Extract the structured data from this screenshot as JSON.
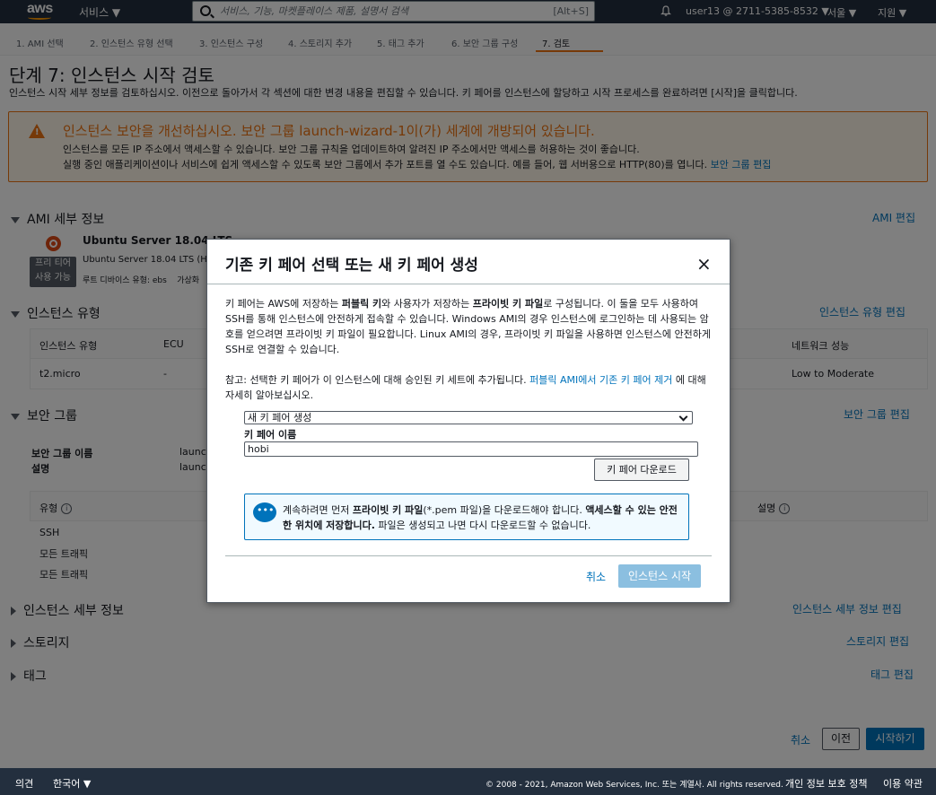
{
  "nav": {
    "logo": "aws",
    "services": "서비스 ▼",
    "search_placeholder": "서비스, 기능, 마켓플레이스 제품, 설명서 검색",
    "search_shortcut": "[Alt+S]",
    "account": "user13 @ 2711-5385-8532 ▼",
    "region": "서울 ▼",
    "support": "지원 ▼"
  },
  "steps": [
    "1. AMI 선택",
    "2. 인스턴스 유형 선택",
    "3. 인스턴스 구성",
    "4. 스토리지 추가",
    "5. 태그 추가",
    "6. 보안 그룹 구성",
    "7. 검토"
  ],
  "page": {
    "title": "단계 7: 인스턴스 시작 검토",
    "subtitle": "인스턴스 시작 세부 정보를 검토하십시오. 이전으로 돌아가서 각 섹션에 대한 변경 내용을 편집할 수 있습니다. 키 페어를 인스턴스에 할당하고 시작 프로세스를 완료하려면 [시작]을 클릭합니다."
  },
  "warning": {
    "title": "인스턴스 보안을 개선하십시오. 보안 그룹 launch-wizard-1이(가) 세계에 개방되어 있습니다.",
    "line1": "인스턴스를 모든 IP 주소에서 액세스할 수 있습니다. 보안 그룹 규칙을 업데이트하여 알려진 IP 주소에서만 액세스를 허용하는 것이 좋습니다.",
    "line2": "실행 중인 애플리케이션이나 서비스에 쉽게 액세스할 수 있도록 보안 그룹에서 추가 포트를 열 수도 있습니다. 예를 들어, 웹 서버용으로 HTTP(80)를 엽니다.",
    "line2_link": "보안 그룹 편집"
  },
  "ami": {
    "heading": "AMI 세부 정보",
    "edit": "AMI 편집",
    "name": "Ubuntu Server 18.04 LTS",
    "sub": "Ubuntu Server 18.04 LTS (H",
    "free_tier_1": "프리 티어",
    "free_tier_2": "사용 가능",
    "root_device": "루트 디바이스 유형: ebs",
    "virt": "가상화"
  },
  "instance_type": {
    "heading": "인스턴스 유형",
    "edit": "인스턴스 유형 편집",
    "columns": [
      "인스턴스 유형",
      "ECU",
      "네트워크 성능"
    ],
    "row": [
      "t2.micro",
      "-",
      "Low to Moderate"
    ]
  },
  "security_group": {
    "heading": "보안 그룹",
    "edit": "보안 그룹 편집",
    "name_label": "보안 그룹 이름",
    "desc_label": "설명",
    "name_value": "launc",
    "desc_value": "launc",
    "col_type": "유형",
    "col_desc": "설명",
    "info": "i",
    "rows": [
      "SSH",
      "모든 트래픽",
      "모든 트래픽"
    ]
  },
  "collapsed": [
    {
      "heading": "인스턴스 세부 정보",
      "edit": "인스턴스 세부 정보 편집"
    },
    {
      "heading": "스토리지",
      "edit": "스토리지 편집"
    },
    {
      "heading": "태그",
      "edit": "태그 편집"
    }
  ],
  "actions": {
    "cancel": "취소",
    "previous": "이전",
    "launch": "시작하기"
  },
  "footer": {
    "feedback": "의견",
    "language": "한국어 ▼",
    "copyright": "© 2008 - 2021, Amazon Web Services, Inc. 또는 계열사. All rights reserved.",
    "privacy": "개인 정보 보호 정책",
    "terms": "이용 약관"
  },
  "modal": {
    "title": "기존 키 페어 선택 또는 새 키 페어 생성",
    "close": "×",
    "para1_a": "키 페어는 AWS에 저장하는 ",
    "para1_b": "퍼블릭 키",
    "para1_c": "와 사용자가 저장하는 ",
    "para1_d": "프라이빗 키 파일",
    "para1_e": "로 구성됩니다. 이 둘을 모두 사용하여 SSH를 통해 인스턴스에 안전하게 접속할 수 있습니다. Windows AMI의 경우 인스턴스에 로그인하는 데 사용되는 암호를 얻으려면 프라이빗 키 파일이 필요합니다. Linux AMI의 경우, 프라이빗 키 파일을 사용하면 인스턴스에 안전하게 SSH로 연결할 수 있습니다.",
    "para2_a": "참고: 선택한 키 페어가 이 인스턴스에 대해 승인된 키 세트에 추가됩니다. ",
    "para2_link": "퍼블릭 AMI에서 기존 키 페어 제거",
    "para2_c": " 에 대해 자세히 알아보십시오.",
    "select_value": "새 키 페어 생성",
    "key_name_label": "키 페어 이름",
    "key_name_value": "hobi",
    "download": "키 페어 다운로드",
    "info_a": "계속하려면 먼저 ",
    "info_b": "프라이빗 키 파일",
    "info_c": "(*.pem 파일)을 다운로드해야 합니다. ",
    "info_d": "액세스할 수 있는 안전한 위치에 저장합니다.",
    "info_e": " 파일은 생성되고 나면 다시 다운로드할 수 없습니다.",
    "cancel": "취소",
    "launch": "인스턴스 시작"
  },
  "colors": {
    "nav_bg": "#232f3e",
    "accent": "#ec7211",
    "link": "#0073bb"
  }
}
